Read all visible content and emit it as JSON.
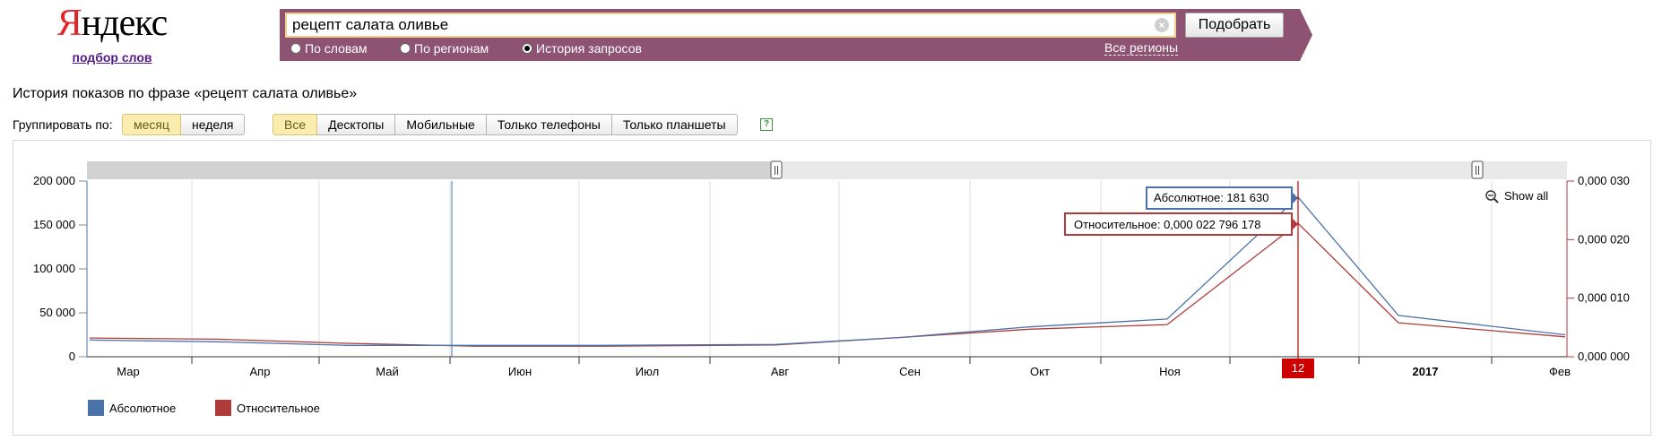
{
  "logo": {
    "text_y": "Я",
    "text_rest": "ндекс",
    "subtitle": "подбор слов"
  },
  "search": {
    "value": "рецепт салата оливье",
    "button_label": "Подобрать",
    "clear_icon": "clear-icon"
  },
  "modes": [
    {
      "label": "По словам",
      "selected": false
    },
    {
      "label": "По регионам",
      "selected": false
    },
    {
      "label": "История запросов",
      "selected": true
    }
  ],
  "regions_link": "Все регионы",
  "page_title": "История показов по фразе «рецепт салата оливье»",
  "group_by": {
    "label": "Группировать по:",
    "options": [
      {
        "label": "месяц",
        "active": true
      },
      {
        "label": "неделя",
        "active": false
      }
    ]
  },
  "devices": [
    {
      "label": "Все",
      "active": true
    },
    {
      "label": "Десктопы",
      "active": false
    },
    {
      "label": "Мобильные",
      "active": false
    },
    {
      "label": "Только телефоны",
      "active": false
    },
    {
      "label": "Только планшеты",
      "active": false
    }
  ],
  "help_icon": "?",
  "colors": {
    "absolute": "#4a72a8",
    "relative": "#b03b3b",
    "brand_bar": "#8e5373",
    "highlight": "#cc0000"
  },
  "chart_data": {
    "type": "line",
    "categories": [
      "Мар",
      "Апр",
      "Май",
      "Июн",
      "Июл",
      "Авг",
      "Сен",
      "Окт",
      "Ноя",
      "Дек",
      "2017",
      "Фев"
    ],
    "series": [
      {
        "name": "Абсолютное",
        "axis": "left",
        "values": [
          19000,
          17000,
          13000,
          13000,
          13000,
          14000,
          22000,
          34000,
          43000,
          181630,
          47000,
          25000
        ]
      },
      {
        "name": "Относительное",
        "axis": "right",
        "values": [
          0.0032,
          0.003,
          0.0023,
          0.0018,
          0.0018,
          0.002,
          0.0033,
          0.0047,
          0.0055,
          2.2796178e-05,
          0.0058,
          0.0034
        ]
      }
    ],
    "left_axis": {
      "ylim": [
        0,
        200000
      ],
      "ticks": [
        "0",
        "50 000",
        "100 000",
        "150 000",
        "200 000"
      ]
    },
    "right_axis": {
      "ylim": [
        0,
        0.03
      ],
      "ticks": [
        "0,000 000",
        "0,000 010",
        "0,000 020",
        "0,000 030"
      ]
    },
    "tooltip_absolute": "Абсолютное: 181 630",
    "tooltip_relative": "Относительное: 0,000 022 796 178",
    "hover_label": "12",
    "show_all": "Show all",
    "legend_placement": "bottom-left"
  }
}
